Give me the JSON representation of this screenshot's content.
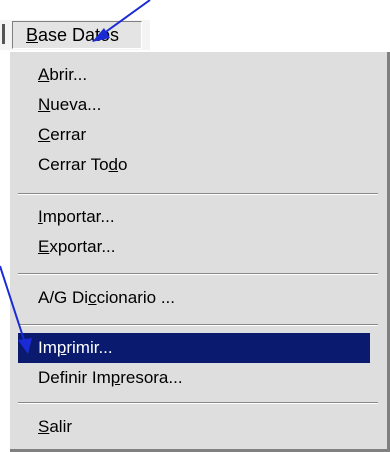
{
  "menubar": {
    "menu_title": "Base Datos"
  },
  "menu": {
    "items": [
      {
        "label": "Abrir...",
        "mnemonic_index": 0
      },
      {
        "label": "Nueva...",
        "mnemonic_index": 0
      },
      {
        "label": "Cerrar",
        "mnemonic_index": 0
      },
      {
        "label": "Cerrar Todo",
        "mnemonic_index": 9
      },
      {
        "label": "Importar...",
        "mnemonic_index": 0
      },
      {
        "label": "Exportar...",
        "mnemonic_index": 0
      },
      {
        "label": "A/G Diccionario ...",
        "mnemonic_index": 6
      },
      {
        "label": "Imprimir...",
        "mnemonic_index": 2,
        "selected": true
      },
      {
        "label": "Definir Impresora...",
        "mnemonic_index": 10
      },
      {
        "label": "Salir",
        "mnemonic_index": 0
      }
    ]
  },
  "colors": {
    "selection_bg": "#0a1a6e",
    "annotation_arrow": "#1a2bd6"
  }
}
